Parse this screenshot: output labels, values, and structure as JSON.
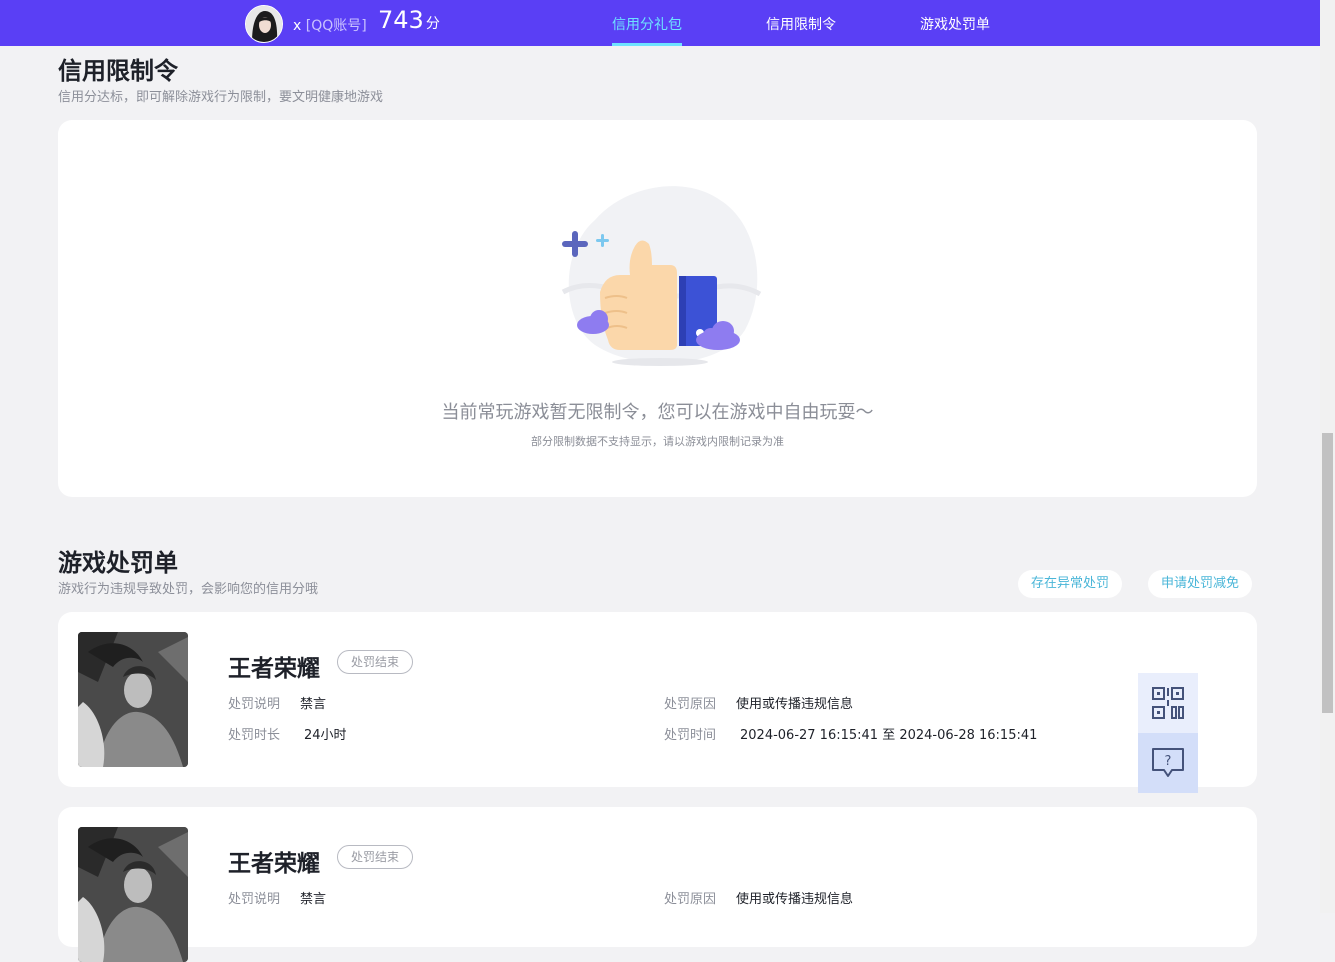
{
  "header": {
    "user_name": "x",
    "account_type": "[QQ账号]",
    "score": "743",
    "score_unit": "分",
    "tabs": [
      {
        "label": "信用分礼包",
        "active": true
      },
      {
        "label": "信用限制令",
        "active": false
      },
      {
        "label": "游戏处罚单",
        "active": false
      }
    ]
  },
  "restriction": {
    "title": "信用限制令",
    "subtitle": "信用分达标，即可解除游戏行为限制，要文明健康地游戏",
    "empty_text": "当前常玩游戏暂无限制令，您可以在游戏中自由玩耍～",
    "empty_note": "部分限制数据不支持显示，请以游戏内限制记录为准"
  },
  "penalty": {
    "title": "游戏处罚单",
    "subtitle": "游戏行为违规导致处罚，会影响您的信用分哦",
    "abnormal_button": "存在异常处罚",
    "appeal_button": "申请处罚减免",
    "labels": {
      "description": "处罚说明",
      "reason": "处罚原因",
      "duration": "处罚时长",
      "time": "处罚时间"
    },
    "records": [
      {
        "game": "王者荣耀",
        "status": "处罚结束",
        "description": "禁言",
        "reason": "使用或传播违规信息",
        "duration": "24小时",
        "time": "2024-06-27 16:15:41 至 2024-06-28 16:15:41"
      },
      {
        "game": "王者荣耀",
        "status": "处罚结束",
        "description": "禁言",
        "reason": "使用或传播违规信息"
      }
    ]
  },
  "colors": {
    "header_bg": "#5a3ff5",
    "active_tab": "#6ee2ff",
    "accent_link": "#4ab6d8"
  },
  "icons": {
    "qr": "qr-code-icon",
    "help": "help-chat-icon",
    "thumb": "thumbs-up-illustration"
  }
}
